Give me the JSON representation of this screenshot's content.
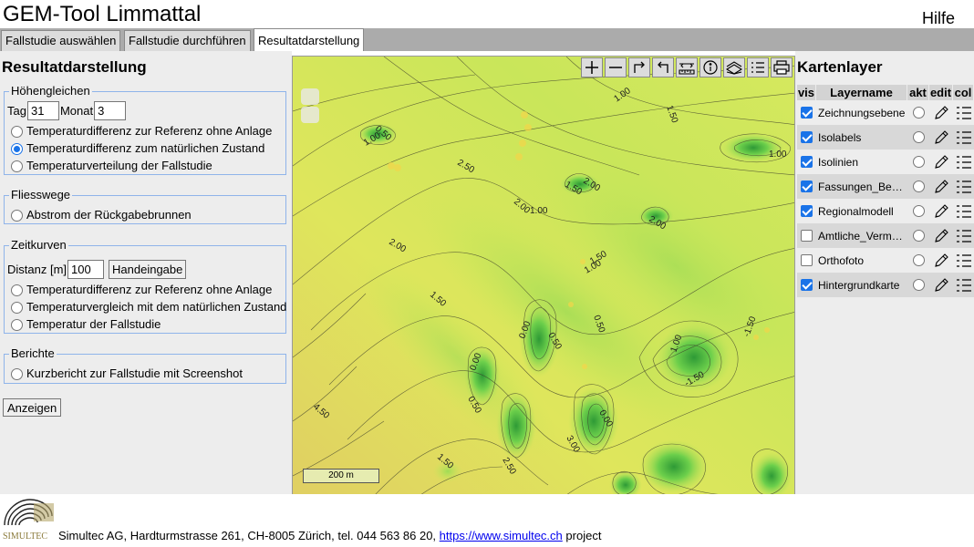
{
  "header": {
    "title": "GEM-Tool Limmattal",
    "help": "Hilfe"
  },
  "tabs": [
    {
      "label": "Fallstudie auswählen"
    },
    {
      "label": "Fallstudie durchführen"
    },
    {
      "label": "Resultatdarstellung",
      "active": true
    }
  ],
  "left": {
    "title": "Resultatdarstellung",
    "hoehengleichen": {
      "legend": "Höhengleichen",
      "tag_label": "Tag",
      "tag_value": "31",
      "monat_label": "Monat",
      "monat_value": "3",
      "options": [
        {
          "label": "Temperaturdifferenz zur Referenz ohne Anlage",
          "selected": false
        },
        {
          "label": "Temperaturdifferenz zum natürlichen Zustand",
          "selected": true
        },
        {
          "label": "Temperaturverteilung der Fallstudie",
          "selected": false
        }
      ]
    },
    "fliesswege": {
      "legend": "Fliesswege",
      "options": [
        {
          "label": "Abstrom der Rückgabebrunnen",
          "selected": false
        }
      ]
    },
    "zeitkurven": {
      "legend": "Zeitkurven",
      "distanz_label": "Distanz [m]",
      "distanz_value": "100",
      "handeingabe": "Handeingabe",
      "options": [
        {
          "label": "Temperaturdifferenz zur Referenz ohne Anlage",
          "selected": false
        },
        {
          "label": "Temperaturvergleich mit dem natürlichen Zustand",
          "selected": false
        },
        {
          "label": "Temperatur der Fallstudie",
          "selected": false
        }
      ]
    },
    "berichte": {
      "legend": "Berichte",
      "options": [
        {
          "label": "Kurzbericht zur Fallstudie mit Screenshot",
          "selected": false
        }
      ]
    },
    "anzeigen": "Anzeigen"
  },
  "map": {
    "toolbar_icons": [
      "zoom-in-icon",
      "zoom-out-icon",
      "undo-icon",
      "redo-icon",
      "measure-icon",
      "info-icon",
      "layers-icon",
      "list-icon",
      "print-icon"
    ],
    "scalebar": "200 m",
    "contour_labels": [
      "1.00",
      "1.50",
      "0.50",
      "1.00",
      "2.50",
      "1.50",
      "2.00",
      "2.00",
      "1.00",
      "2.00",
      "2.00",
      "1.50",
      "1.00",
      "1.50",
      "0.50",
      "0.00",
      "0.50",
      "0.00",
      "0.50",
      "1.00",
      "-1.50",
      "4.50",
      "0.00",
      "3.00",
      "1.50",
      "2.50",
      "-1.50",
      "1.00"
    ],
    "colors": {
      "high": "#e3e75a",
      "mid": "#c6e85a",
      "low": "#6ccf4b",
      "dark": "#3aa83a",
      "warm": "#e0c860"
    }
  },
  "right": {
    "title": "Kartenlayer",
    "headers": {
      "vis": "vis",
      "name": "Layername",
      "akt": "akt",
      "edit": "edit",
      "col": "col"
    },
    "layers": [
      {
        "name": "Zeichnungsebene",
        "visible": true
      },
      {
        "name": "Isolabels",
        "visible": true
      },
      {
        "name": "Isolinien",
        "visible": true
      },
      {
        "name": "Fassungen_Bestand",
        "visible": true
      },
      {
        "name": "Regionalmodell",
        "visible": true
      },
      {
        "name": "Amtliche_Vermessung",
        "visible": false
      },
      {
        "name": "Orthofoto",
        "visible": false
      },
      {
        "name": "Hintergrundkarte",
        "visible": true
      }
    ]
  },
  "footer": {
    "logo_text": "SIMULTEC",
    "text_before": "Simultec AG, Hardturmstrasse 261, CH-8005 Zürich, tel. 044 563 86 20,",
    "link": "https://www.simultec.ch",
    "text_after": "project"
  }
}
